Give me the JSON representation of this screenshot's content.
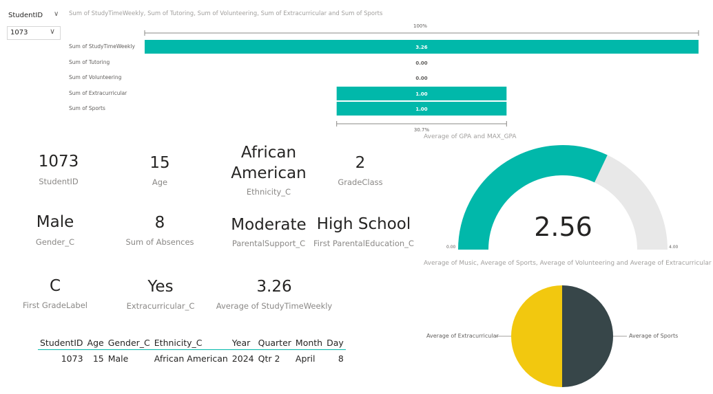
{
  "slicer": {
    "title": "StudentID",
    "selected": "1073"
  },
  "funnel": {
    "title": "Sum of StudyTimeWeekly, Sum of Tutoring, Sum of Volunteering, Sum of Extracurricular and Sum of Sports",
    "top_pct": "100%",
    "bottom_pct": "30.7%",
    "accent": "#01B8AA"
  },
  "chart_data": [
    {
      "type": "bar",
      "title": "Sum of StudyTimeWeekly, Sum of Tutoring, Sum of Volunteering, Sum of Extracurricular and Sum of Sports",
      "categories": [
        "Sum of StudyTimeWeekly",
        "Sum of Tutoring",
        "Sum of Volunteering",
        "Sum of Extracurricular",
        "Sum of Sports"
      ],
      "values": [
        3.26,
        0.0,
        0.0,
        1.0,
        1.0
      ],
      "value_labels": [
        "3.26",
        "0.00",
        "0.00",
        "1.00",
        "1.00"
      ],
      "orientation": "horizontal-centered-funnel",
      "ylim": [
        0,
        3.26
      ]
    },
    {
      "type": "gauge",
      "title": "Average of GPA and MAX_GPA",
      "value": 2.56,
      "value_label": "2.56",
      "min": 0,
      "max": 4,
      "min_label": "0.00",
      "max_label": "4.00",
      "colors": {
        "fill": "#01B8AA",
        "track": "#E8E8E8"
      }
    },
    {
      "type": "pie",
      "title": "Average of Music, Average of Sports, Average of Volunteering and Average of Extracurricular",
      "series": [
        {
          "name": "Average of Sports",
          "value": 1,
          "color": "#374649"
        },
        {
          "name": "Average of Extracurricular",
          "value": 1,
          "color": "#F2C80F"
        }
      ]
    }
  ],
  "cards": [
    {
      "value": "1073",
      "label": "StudentID"
    },
    {
      "value": "15",
      "label": "Age"
    },
    {
      "value": "African American",
      "label": "Ethnicity_C"
    },
    {
      "value": "2",
      "label": "GradeClass"
    },
    {
      "value": "Male",
      "label": "Gender_C"
    },
    {
      "value": "8",
      "label": "Sum of Absences"
    },
    {
      "value": "Moderate",
      "label": "ParentalSupport_C"
    },
    {
      "value": "High School",
      "label": "First ParentalEducation_C"
    },
    {
      "value": "C",
      "label": "First GradeLabel"
    },
    {
      "value": "Yes",
      "label": "Extracurricular_C"
    },
    {
      "value": "3.26",
      "label": "Average of StudyTimeWeekly"
    }
  ],
  "ethnicity_lines": [
    "African",
    "American"
  ],
  "table": {
    "headers": [
      "StudentID",
      "Age",
      "Gender_C",
      "Ethnicity_C",
      "Year",
      "Quarter",
      "Month",
      "Day"
    ],
    "rows": [
      [
        "1073",
        "15",
        "Male",
        "African American",
        "2024",
        "Qtr 2",
        "April",
        "8"
      ]
    ]
  }
}
